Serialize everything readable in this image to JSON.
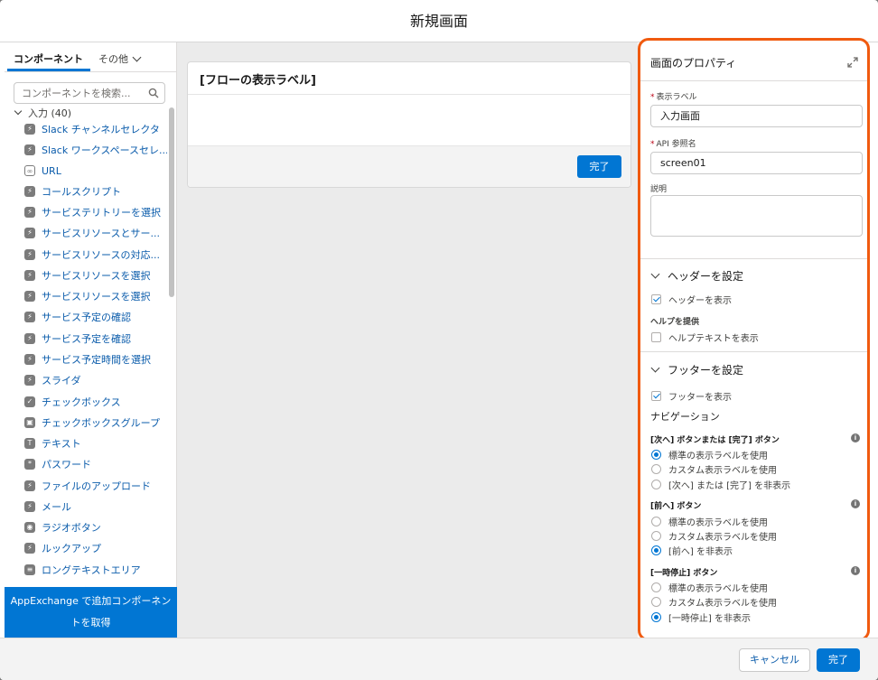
{
  "modal": {
    "title": "新規画面"
  },
  "sidebar": {
    "tab_components": "コンポーネント",
    "tab_other": "その他",
    "search_placeholder": "コンポーネントを検索...",
    "group_label": "入力 (40)",
    "items": [
      {
        "label": "Slack チャンネルセレクタ",
        "icon": "bolt-icon"
      },
      {
        "label": "Slack ワークスペースセレ...",
        "icon": "bolt-icon"
      },
      {
        "label": "URL",
        "icon": "link-icon"
      },
      {
        "label": "コールスクリプト",
        "icon": "bolt-icon"
      },
      {
        "label": "サービステリトリーを選択",
        "icon": "bolt-icon"
      },
      {
        "label": "サービスリソースとサー...",
        "icon": "bolt-icon"
      },
      {
        "label": "サービスリソースの対応...",
        "icon": "bolt-icon"
      },
      {
        "label": "サービスリソースを選択",
        "icon": "bolt-icon"
      },
      {
        "label": "サービスリソースを選択",
        "icon": "bolt-icon"
      },
      {
        "label": "サービス予定の確認",
        "icon": "bolt-icon"
      },
      {
        "label": "サービス予定を確認",
        "icon": "bolt-icon"
      },
      {
        "label": "サービス予定時間を選択",
        "icon": "bolt-icon"
      },
      {
        "label": "スライダ",
        "icon": "bolt-icon"
      },
      {
        "label": "チェックボックス",
        "icon": "checkbox-icon"
      },
      {
        "label": "チェックボックスグループ",
        "icon": "checkbox-group-icon"
      },
      {
        "label": "テキスト",
        "icon": "text-icon"
      },
      {
        "label": "パスワード",
        "icon": "password-icon"
      },
      {
        "label": "ファイルのアップロード",
        "icon": "bolt-icon"
      },
      {
        "label": "メール",
        "icon": "bolt-icon"
      },
      {
        "label": "ラジオボタン",
        "icon": "radio-icon"
      },
      {
        "label": "ルックアップ",
        "icon": "bolt-icon"
      },
      {
        "label": "ロングテキストエリア",
        "icon": "textarea-icon"
      }
    ],
    "appexchange_line1": "AppExchange で追加コンポーネン",
    "appexchange_line2": "トを取得"
  },
  "canvas": {
    "card_title": "[フローの表示ラベル]",
    "done_label": "完了"
  },
  "properties": {
    "title": "画面のプロパティ",
    "display_label_label": "表示ラベル",
    "display_label_value": "入力画面",
    "api_name_label": "API 参照名",
    "api_name_value": "screen01",
    "description_label": "説明",
    "header_section": "ヘッダーを設定",
    "show_header": "ヘッダーを表示",
    "help_label": "ヘルプを提供",
    "show_help": "ヘルプテキストを表示",
    "footer_section": "フッターを設定",
    "show_footer": "フッターを表示",
    "navigation_label": "ナビゲーション",
    "next_group_label": "[次へ] ボタンまたは [完了] ボタン",
    "next_options": [
      "標準の表示ラベルを使用",
      "カスタム表示ラベルを使用",
      "[次へ] または [完了] を非表示"
    ],
    "prev_group_label": "[前へ] ボタン",
    "prev_options": [
      "標準の表示ラベルを使用",
      "カスタム表示ラベルを使用",
      "[前へ] を非表示"
    ],
    "pause_group_label": "[一時停止] ボタン",
    "pause_options": [
      "標準の表示ラベルを使用",
      "カスタム表示ラベルを使用",
      "[一時停止] を非表示"
    ],
    "info_glyph": "i"
  },
  "footer": {
    "cancel_label": "キャンセル",
    "finish_label": "完了"
  },
  "colors": {
    "brand_blue": "#0176d3",
    "highlight_orange": "#f05a0f"
  }
}
